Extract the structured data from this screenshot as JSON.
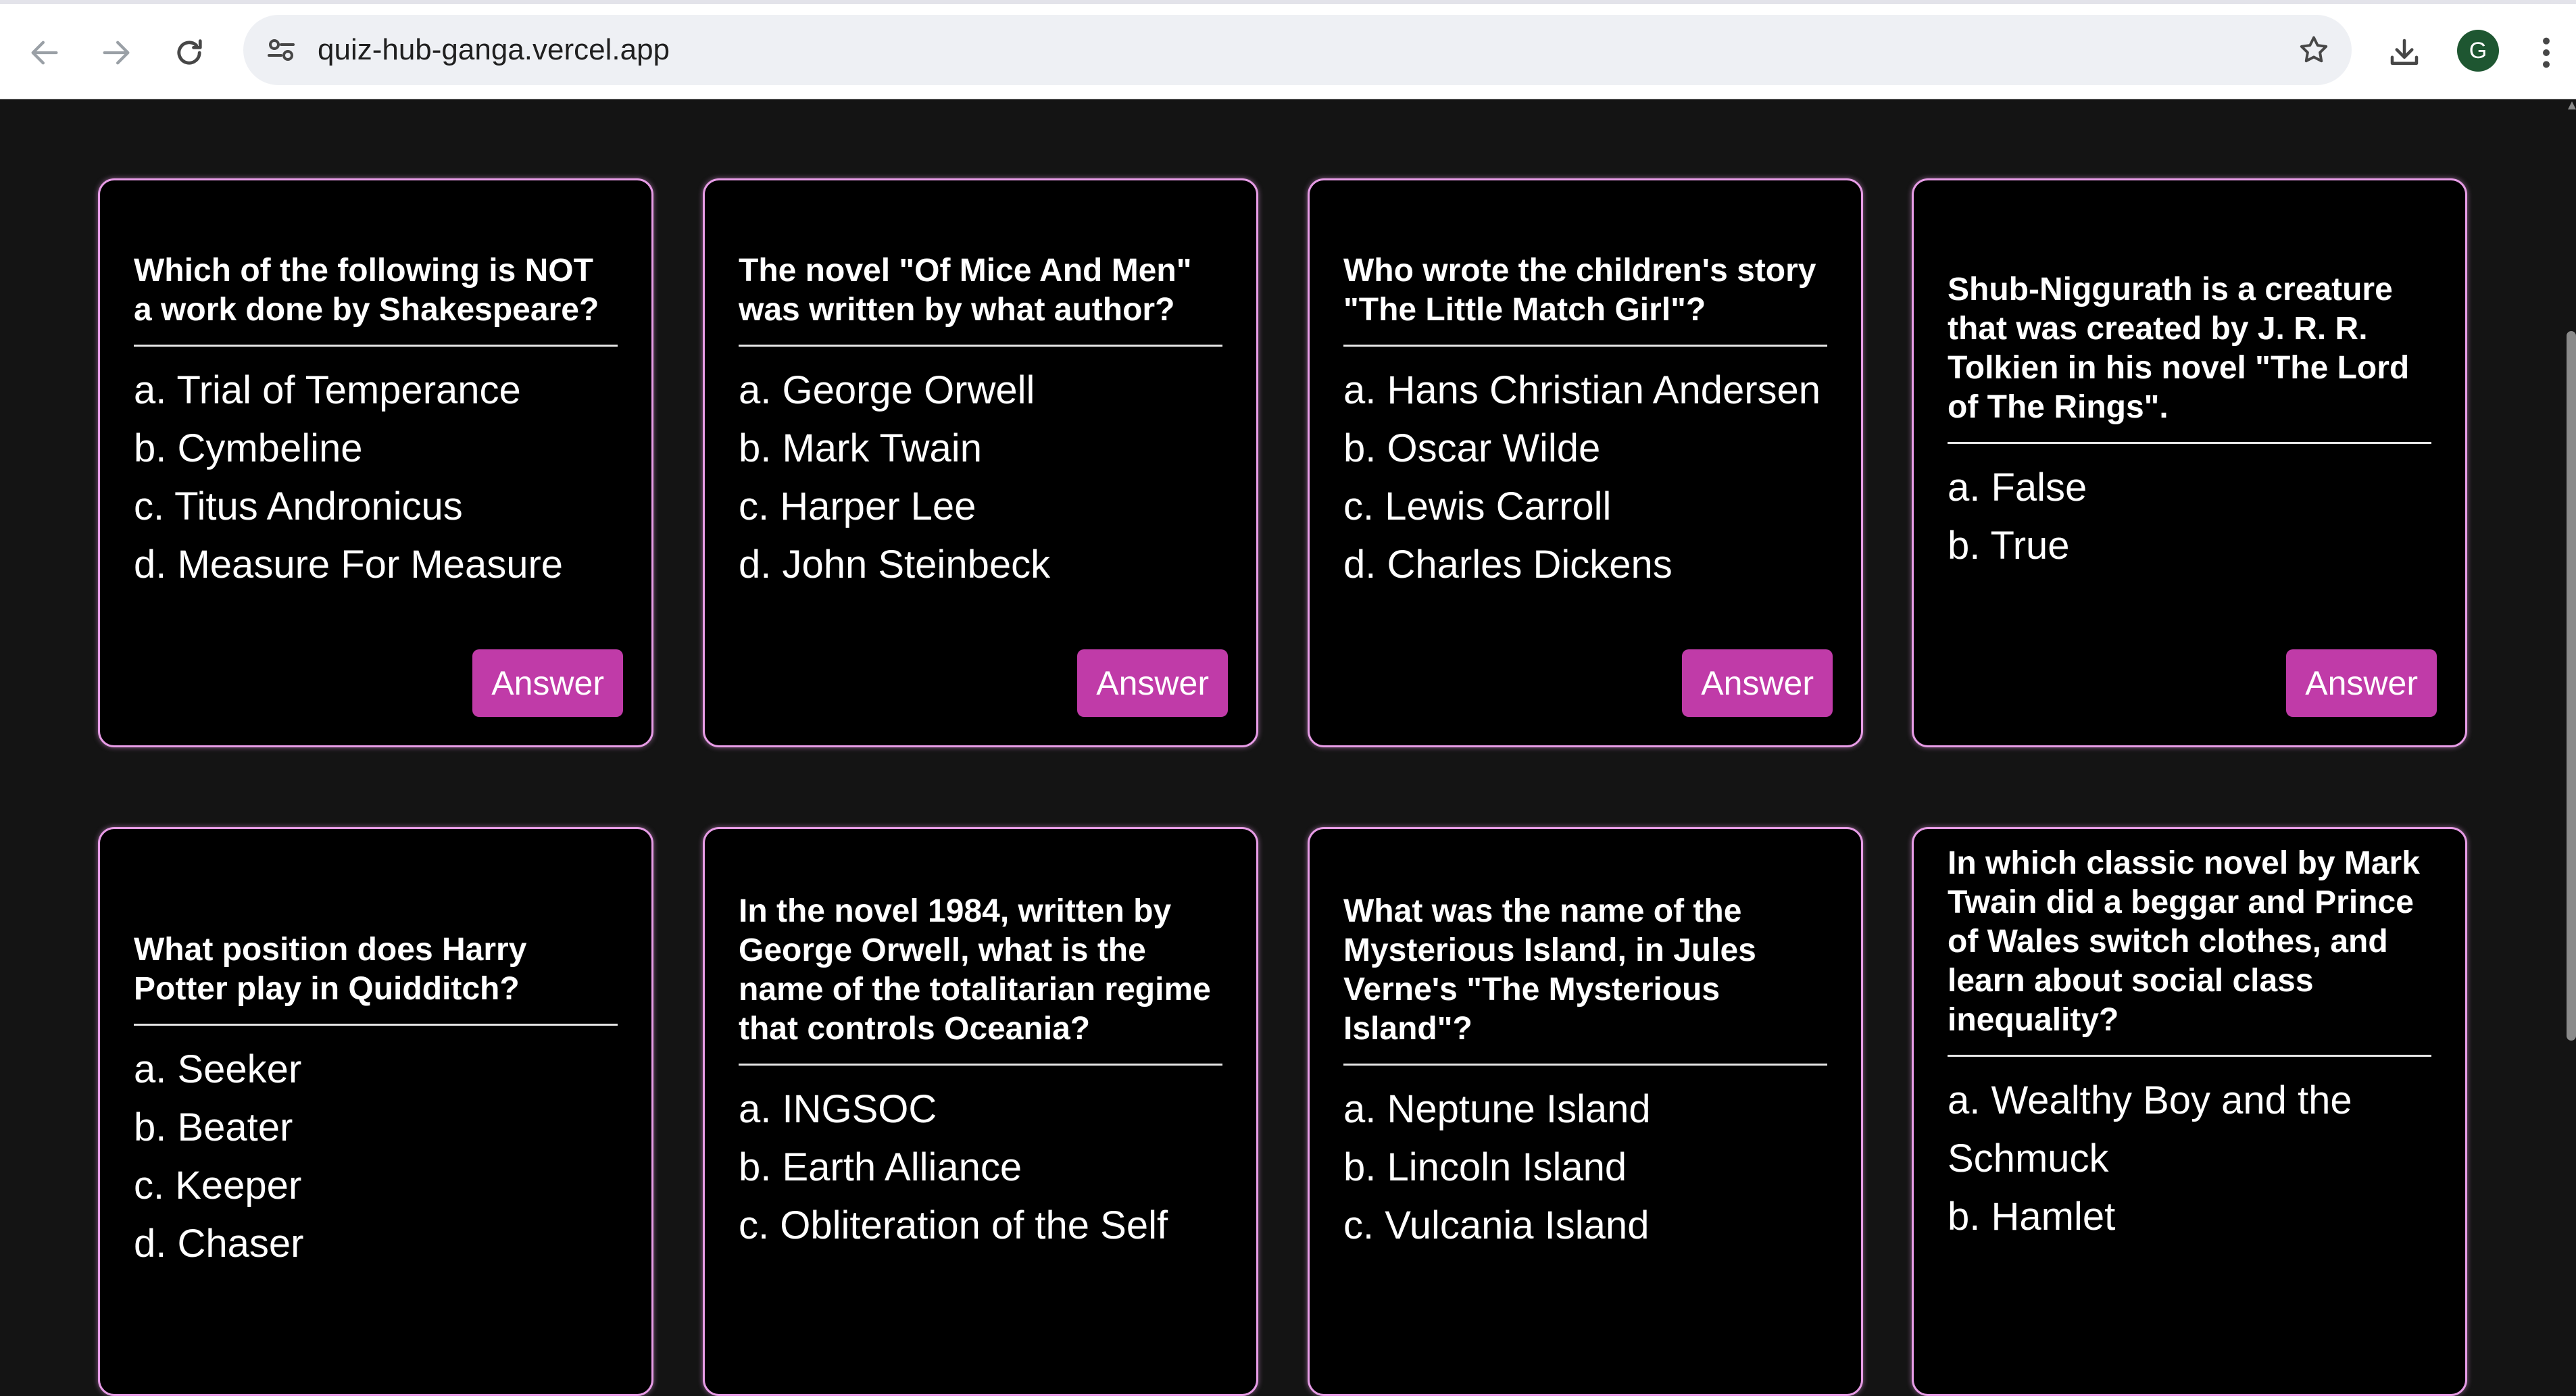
{
  "browser": {
    "url": "quiz-hub-ganga.vercel.app",
    "profile_initial": "G",
    "icons": {
      "back": "arrow-left-icon",
      "forward": "arrow-right-icon",
      "reload": "reload-icon",
      "site_info": "tune-icon",
      "bookmark": "star-icon",
      "download": "download-icon",
      "menu": "kebab-menu-icon"
    }
  },
  "theme": {
    "card_border": "#e79ce6",
    "button": "#c03ba8",
    "page_bg": "#141414"
  },
  "cards": [
    {
      "question": "Which of the following is NOT a work done by Shakespeare?",
      "options": [
        "a. Trial of Temperance",
        "b. Cymbeline",
        "c. Titus Andronicus",
        "d. Measure For Measure"
      ],
      "button": "Answer"
    },
    {
      "question": "The novel \"Of Mice And Men\" was written by what author?",
      "options": [
        "a. George Orwell",
        "b. Mark Twain",
        "c. Harper Lee",
        "d. John Steinbeck"
      ],
      "button": "Answer"
    },
    {
      "question": "Who wrote the children's story \"The Little Match Girl\"?",
      "options": [
        "a. Hans Christian Andersen",
        "b. Oscar Wilde",
        "c. Lewis Carroll",
        "d. Charles Dickens"
      ],
      "button": "Answer"
    },
    {
      "question": "Shub-Niggurath is a creature that was created by J. R. R. Tolkien in his novel \"The Lord of The Rings\".",
      "options": [
        "a. False",
        "b. True"
      ],
      "button": "Answer"
    },
    {
      "question": "What position does Harry Potter play in Quidditch?",
      "options": [
        "a. Seeker",
        "b. Beater",
        "c. Keeper",
        "d. Chaser"
      ]
    },
    {
      "question": "In the novel 1984, written by George Orwell, what is the name of the totalitarian regime that controls Oceania?",
      "options": [
        "a. INGSOC",
        "b. Earth Alliance",
        "c. Obliteration of the Self"
      ]
    },
    {
      "question": "What was the name of the Mysterious Island, in Jules Verne's \"The Mysterious Island\"?",
      "options": [
        "a. Neptune Island",
        "b. Lincoln Island",
        "c. Vulcania Island"
      ]
    },
    {
      "question": "In which classic novel by Mark Twain did a beggar and Prince of Wales switch clothes, and learn about social class inequality?",
      "options": [
        "a. Wealthy Boy and the Schmuck",
        "b. Hamlet"
      ]
    }
  ]
}
